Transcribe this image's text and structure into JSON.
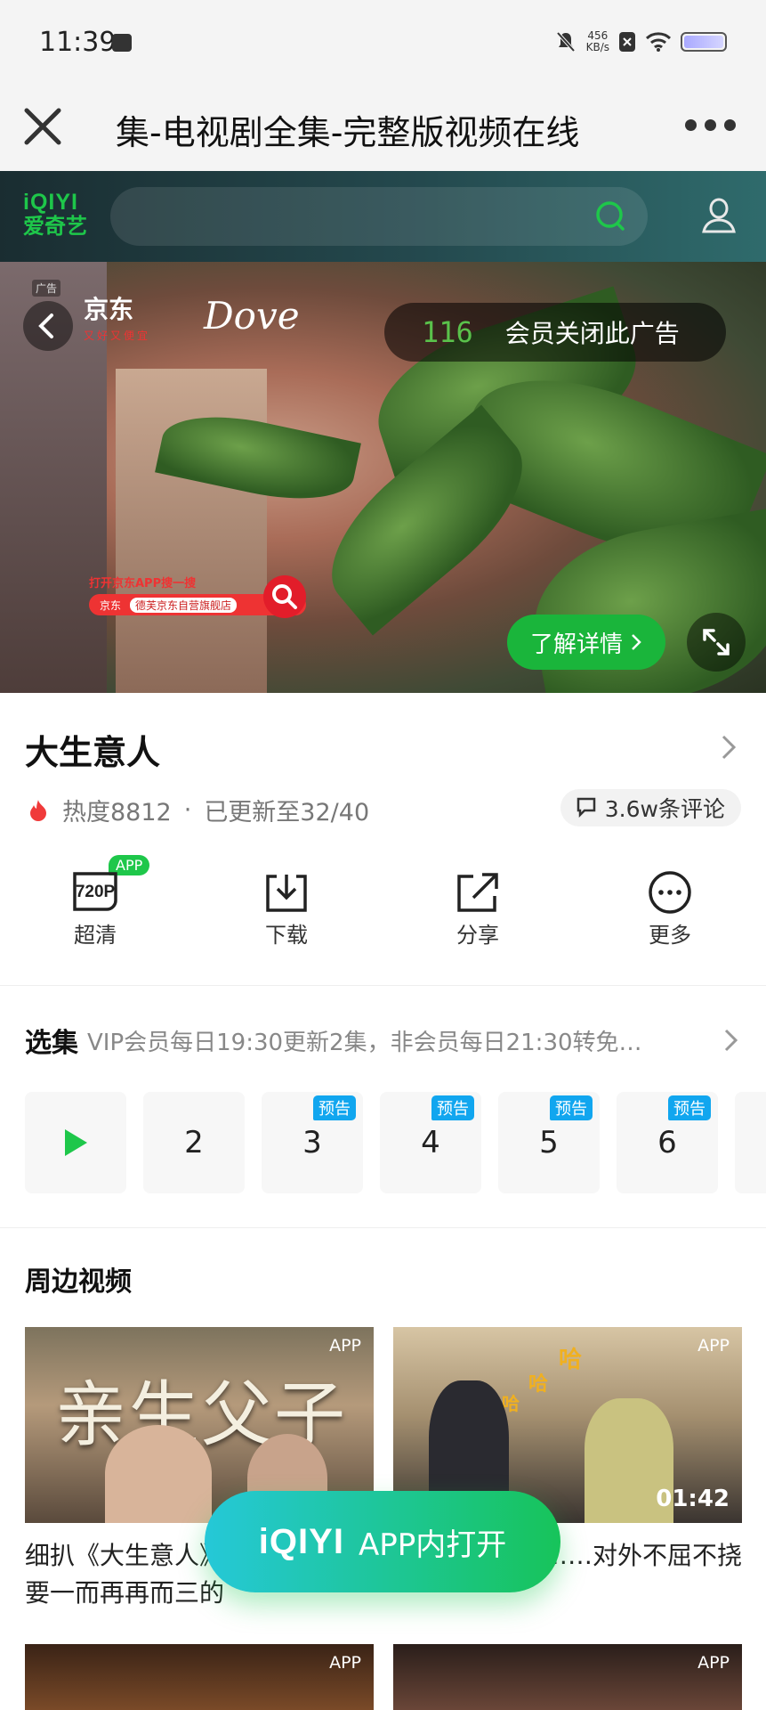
{
  "status_bar": {
    "time": "11:39",
    "net_speed": "456",
    "net_unit": "KB/s"
  },
  "nav": {
    "title": "集-电视剧全集-完整版视频在线"
  },
  "iqiyi": {
    "logo_en": "iQIYI",
    "logo_cn": "爱奇艺"
  },
  "ad": {
    "tag": "广告",
    "brand_jd": "京东",
    "brand_jd_sub": "又好又便宜",
    "brand_dove_small": "德芙",
    "brand_dove": "Dove",
    "countdown": "116",
    "close_label": "会员关闭此广告",
    "jd_banner_top": "打开京东APP搜一搜",
    "jd_banner_name": "京东",
    "jd_banner_store": "德芙京东自营旗舰店",
    "detail_label": "了解详情"
  },
  "show": {
    "title": "大生意人",
    "heat": "热度8812",
    "dot": "·",
    "update": "已更新至32/40",
    "comments": "3.6w条评论"
  },
  "actions": [
    {
      "label": "超清",
      "icon_text": "720P",
      "badge": "APP"
    },
    {
      "label": "下载"
    },
    {
      "label": "分享"
    },
    {
      "label": "更多"
    }
  ],
  "episodes_section": {
    "title": "选集",
    "subtitle": "VIP会员每日19:30更新2集，非会员每日21:30转免…",
    "items": [
      {
        "num": ""
      },
      {
        "num": "2"
      },
      {
        "num": "3",
        "tag": "预告"
      },
      {
        "num": "4",
        "tag": "预告"
      },
      {
        "num": "5",
        "tag": "预告"
      },
      {
        "num": "6",
        "tag": "预告"
      }
    ]
  },
  "related": {
    "title": "周边视频",
    "videos": [
      {
        "thumb_text": "亲生父子",
        "badge": "APP",
        "title": "细扒《大生意人》……啥李万堂要一而再再而三的"
      },
      {
        "badge": "APP",
        "duration": "01:42",
        "title": "……对外不屈不挠",
        "caption_a": "哈",
        "caption_b": "哈",
        "caption_c": "哈"
      },
      {
        "badge": "APP"
      },
      {
        "badge": "APP"
      }
    ]
  },
  "open_app": {
    "logo": "iQIYI",
    "label": "APP内打开"
  }
}
